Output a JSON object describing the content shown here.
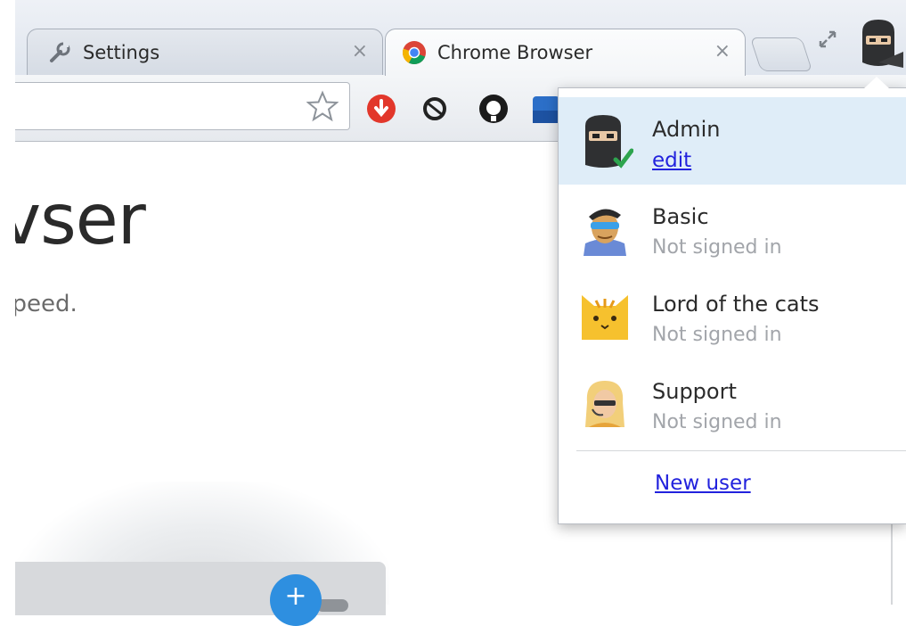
{
  "tabs": [
    {
      "title": "Settings",
      "icon": "wrench-icon",
      "close": "×"
    },
    {
      "title": "Chrome Browser",
      "icon": "chrome-icon",
      "close": "×"
    }
  ],
  "page": {
    "title_fragment": "vser",
    "subtitle_fragment": "speed.",
    "add_label": "+"
  },
  "profile_menu": {
    "profiles": [
      {
        "name": "Admin",
        "link": "edit",
        "avatar": "ninja-avatar-icon"
      },
      {
        "name": "Basic",
        "status": "Not signed in",
        "avatar": "masked-man-avatar-icon"
      },
      {
        "name": "Lord of the cats",
        "status": "Not signed in",
        "avatar": "cat-avatar-icon"
      },
      {
        "name": "Support",
        "status": "Not signed in",
        "avatar": "support-agent-avatar-icon"
      }
    ],
    "new_user_label": "New user"
  },
  "colors": {
    "selected_row": "#dfedf8",
    "link": "#2222dd",
    "status_text": "#a2a5aa",
    "add_button": "#2e8fe0"
  }
}
